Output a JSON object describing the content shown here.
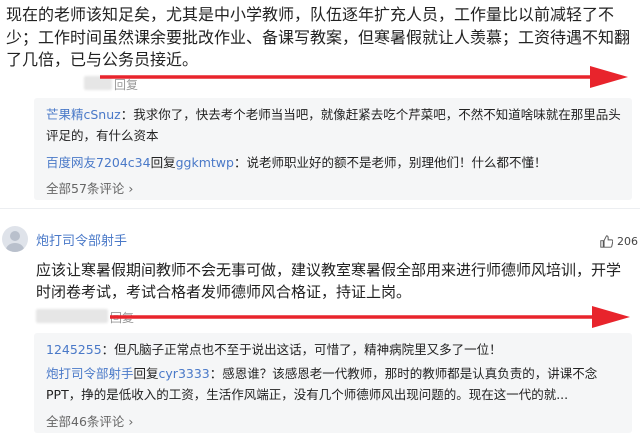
{
  "comment1": {
    "text": "现在的老师该知足矣，尤其是中小学教师，队伍逐年扩充人员，工作量比以前减轻了不少；工作时间虽然课余要批改作业、备课写教案，但寒暑假就让人羡慕；工资待遇不知翻了几倍，已与公务员接近。",
    "reply_label": "回复"
  },
  "replies1": [
    {
      "user": "芒果精cSnuz",
      "text": "：我求你了，快去考个老师当当吧，就像赶紧去吃个芹菜吧，不然不知道啥味就在那里品头评足的，有什么资本"
    },
    {
      "user": "百度网友7204c34",
      "reply_word": "回复",
      "target": "ggkmtwp",
      "text": "：说老师职业好的额不是老师，别理他们！什么都不懂！"
    }
  ],
  "more1": "全部57条评论 ›",
  "comment2": {
    "username": "炮打司令部射手",
    "likes": "206",
    "text": "应该让寒暑假期间教师不会无事可做，建议教室寒暑假全部用来进行师德师风培训，开学时闭卷考试，考试合格者发师德师风合格证，持证上岗。",
    "reply_label": "回复"
  },
  "replies2": [
    {
      "user": "1245255",
      "text": "：但凡脑子正常点也不至于说出这话，可惜了，精神病院里又多了一位！"
    },
    {
      "user": "炮打司令部射手",
      "reply_word": "回复",
      "target": "cyr3333",
      "text": "：感恩谁？该感恩老一代教师，那时的教师都是认真负责的，讲课不念PPT，挣的是低收入的工资，生活作风端正，没有几个师德师风出现问题的。现在这一代的就..."
    }
  ],
  "more2": "全部46条评论 ›",
  "colors": {
    "annotation_arrow": "#e8242c",
    "username": "#4a79c8",
    "reply_bg": "#f5f6f7"
  }
}
